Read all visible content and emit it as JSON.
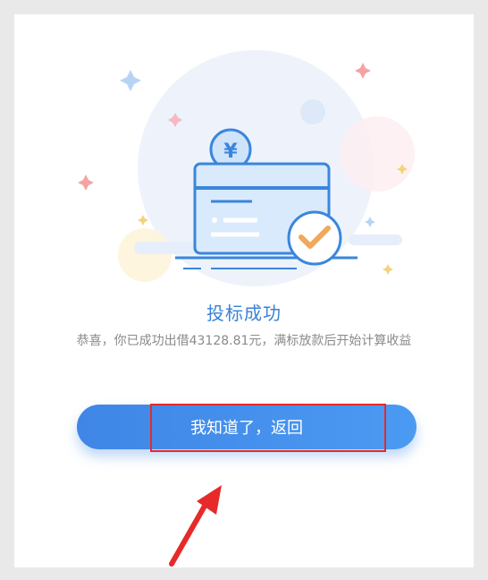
{
  "success": {
    "title": "投标成功",
    "message": "恭喜，你已成功出借43128.81元，满标放款后开始计算收益",
    "currency_symbol": "¥"
  },
  "actions": {
    "return_button_label": "我知道了，返回"
  },
  "colors": {
    "page_background": "#e9e9e9",
    "card_background": "#ffffff",
    "accent_blue": "#3a82d6",
    "button_gradient_start": "#3f86e6",
    "button_gradient_end": "#4b9af2",
    "check_orange": "#f0a85a",
    "annotation_red": "#e62a2a",
    "message_text": "#8a8a8a"
  },
  "icons": {
    "illustration": "card-with-coin-and-check-illustration",
    "annotation": "red-arrow-pointing-to-button"
  }
}
